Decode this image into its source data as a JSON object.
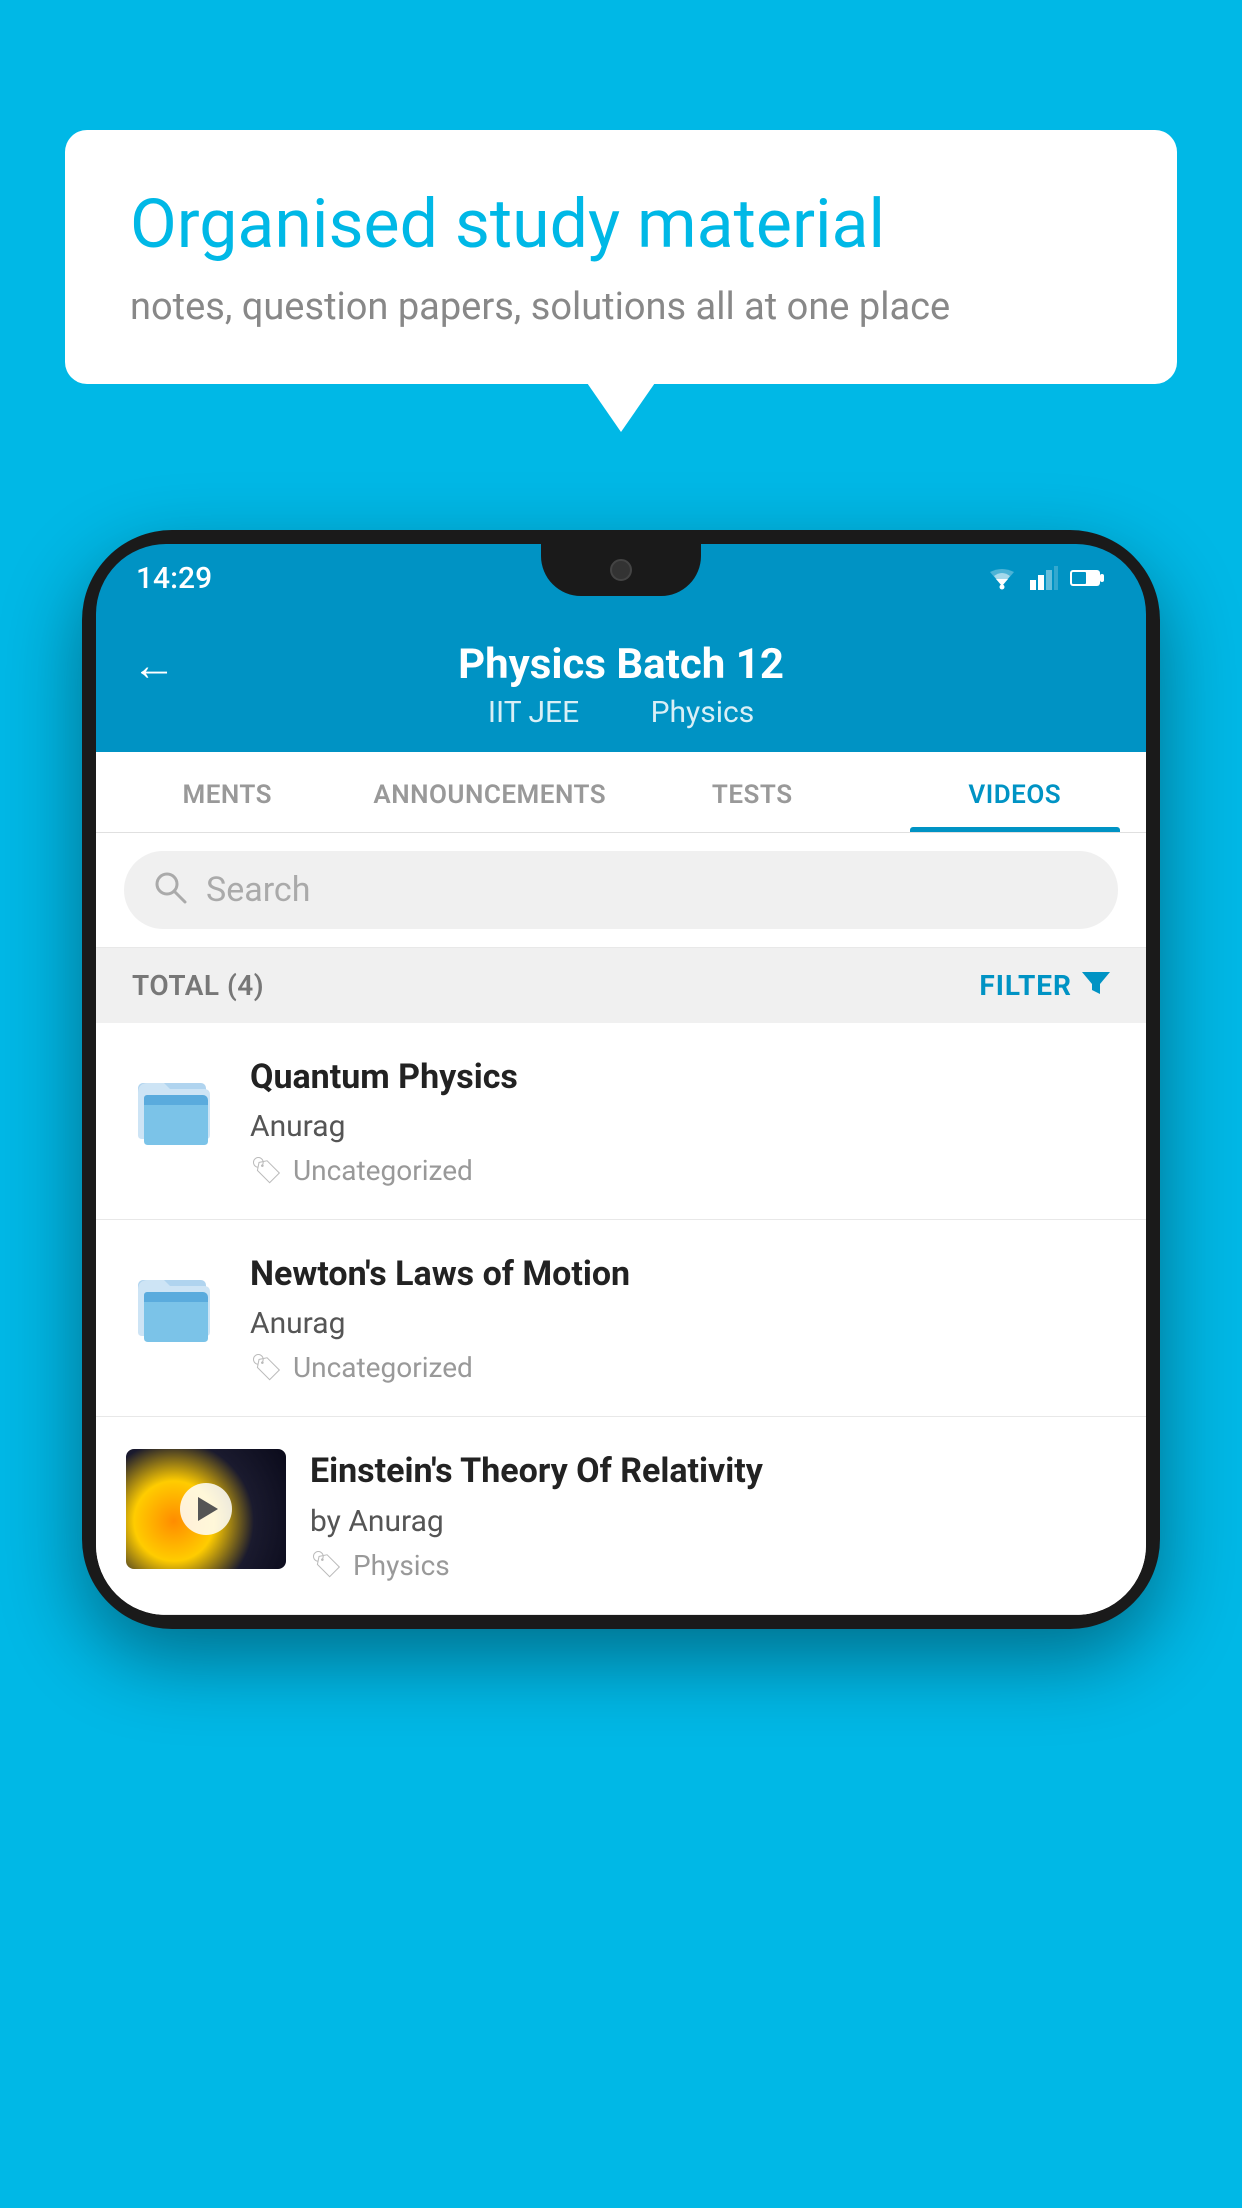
{
  "background_color": "#00b8e6",
  "speech_bubble": {
    "title": "Organised study material",
    "subtitle": "notes, question papers, solutions all at one place"
  },
  "phone": {
    "status_bar": {
      "time": "14:29"
    },
    "header": {
      "title": "Physics Batch 12",
      "subtitle_parts": [
        "IIT JEE",
        "Physics"
      ],
      "back_label": "←"
    },
    "tabs": [
      {
        "label": "MENTS",
        "active": false
      },
      {
        "label": "ANNOUNCEMENTS",
        "active": false
      },
      {
        "label": "TESTS",
        "active": false
      },
      {
        "label": "VIDEOS",
        "active": true
      }
    ],
    "search": {
      "placeholder": "Search"
    },
    "filter_row": {
      "total_label": "TOTAL (4)",
      "filter_label": "FILTER"
    },
    "videos": [
      {
        "id": "1",
        "title": "Quantum Physics",
        "author": "Anurag",
        "tag": "Uncategorized",
        "has_thumbnail": false
      },
      {
        "id": "2",
        "title": "Newton's Laws of Motion",
        "author": "Anurag",
        "tag": "Uncategorized",
        "has_thumbnail": false
      },
      {
        "id": "3",
        "title": "Einstein's Theory Of Relativity",
        "author": "by Anurag",
        "tag": "Physics",
        "has_thumbnail": true
      }
    ]
  }
}
